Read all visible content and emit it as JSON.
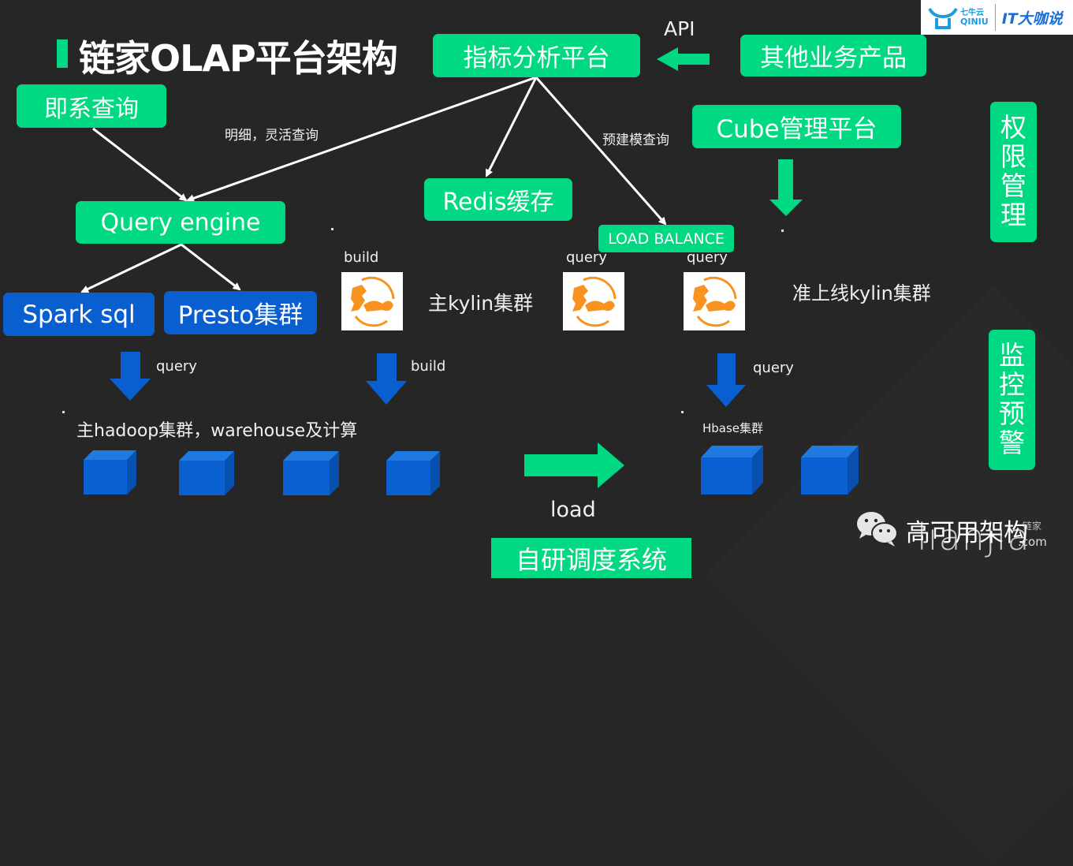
{
  "title": "链家OLAP平台架构",
  "sponsor_logo": {
    "qiniu_cn": "七牛云",
    "qiniu_en": "QINIU",
    "it_talk": "IT大咖说"
  },
  "nodes": {
    "metrics_platform": "指标分析平台",
    "other_products": "其他业务产品",
    "api_label": "API",
    "adhoc_query": "即系查询",
    "cube_mgmt": "Cube管理平台",
    "query_engine": "Query engine",
    "redis_cache": "Redis缓存",
    "load_balance": "LOAD BALANCE",
    "spark_sql": "Spark sql",
    "presto": "Presto集群",
    "main_kylin": "主kylin集群",
    "pre_kylin": "准上线kylin集群",
    "main_hadoop": "主hadoop集群，warehouse及计算",
    "hbase": "Hbase集群",
    "scheduler": "自研调度系统",
    "permission": [
      "权",
      "限",
      "管",
      "理"
    ],
    "monitoring": [
      "监",
      "控",
      "预",
      "警"
    ]
  },
  "edge_labels": {
    "detail_flexible": "明细，灵活查询",
    "prebuilt_query": "预建模查询",
    "build_top": "build",
    "query_kylin1": "query",
    "query_kylin2": "query",
    "query_spark": "query",
    "build_hadoop": "build",
    "query_hbase": "query",
    "load": "load"
  },
  "watermark": {
    "wechat_account": "高可用架构",
    "brand": "lianjia",
    "brand_cn": "链家",
    "domain": ".com"
  },
  "colors": {
    "background": "#262626",
    "green": "#00d982",
    "blue": "#0a5fd0",
    "kylin_orange": "#f7931e"
  }
}
